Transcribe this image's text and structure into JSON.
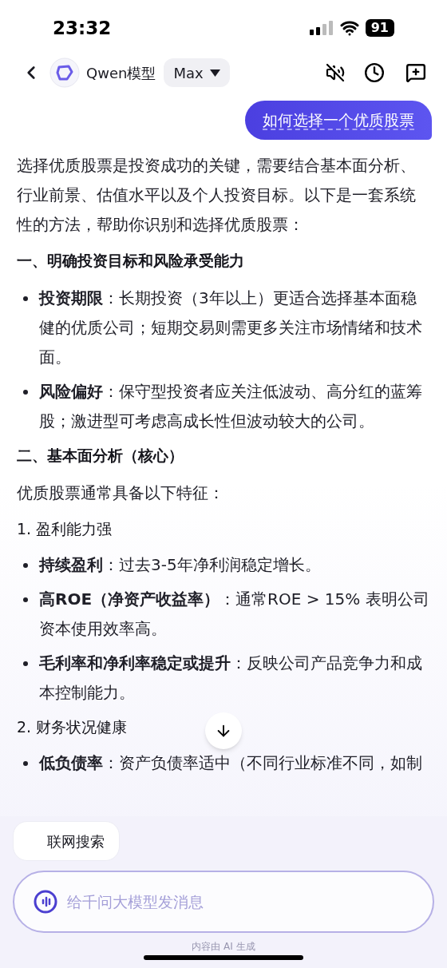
{
  "status_bar": {
    "time": "23:32",
    "battery": "91"
  },
  "header": {
    "title": "Qwen模型",
    "model": "Max"
  },
  "user_message": "如何选择一个优质股票",
  "answer": [
    {
      "kind": "paragraph",
      "text": "选择优质股票是投资成功的关键，需要结合基本面分析、行业前景、估值水平以及个人投资目标。以下是一套系统性的方法，帮助你识别和选择优质股票："
    },
    {
      "kind": "heading",
      "text": "一、明确投资目标和风险承受能力"
    },
    {
      "kind": "bullet",
      "text": "**投资期限**：长期投资（3年以上）更适合选择基本面稳健的优质公司；短期交易则需更多关注市场情绪和技术面。"
    },
    {
      "kind": "bullet",
      "text": "**风险偏好**：保守型投资者应关注低波动、高分红的蓝筹股；激进型可考虑高成长性但波动较大的公司。"
    },
    {
      "kind": "heading",
      "text": "二、基本面分析（核心）"
    },
    {
      "kind": "paragraph",
      "text": "优质股票通常具备以下特征："
    },
    {
      "kind": "subheading",
      "text": "1. 盈利能力强"
    },
    {
      "kind": "bullet",
      "text": "**持续盈利**：过去3-5年净利润稳定增长。"
    },
    {
      "kind": "bullet",
      "text": "**高ROE（净资产收益率）**：通常ROE > 15% 表明公司资本使用效率高。"
    },
    {
      "kind": "bullet",
      "text": "**毛利率和净利率稳定或提升**：反映公司产品竞争力和成本控制能力。"
    },
    {
      "kind": "subheading",
      "text": "2. 财务状况健康"
    },
    {
      "kind": "bullet",
      "text": "**低负债率**：资产负债率适中（不同行业标准不同，如制"
    }
  ],
  "chips": [
    {
      "label": "联网搜索"
    }
  ],
  "input": {
    "placeholder": "给千问大模型发消息"
  },
  "footer_note": "内容由 AI 生成"
}
